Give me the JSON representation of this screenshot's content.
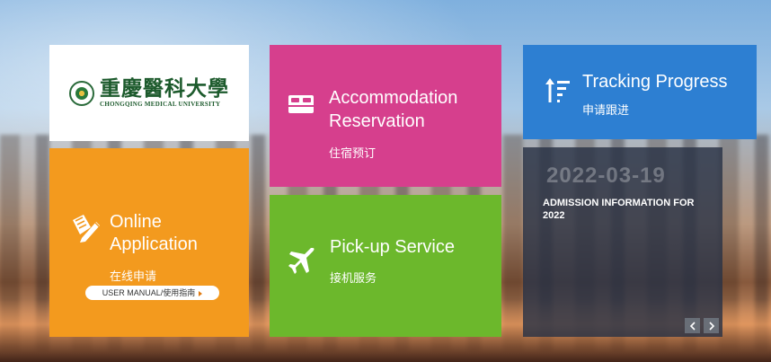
{
  "logo": {
    "name_cn": "重慶醫科大學",
    "name_en": "CHONGQING MEDICAL UNIVERSITY",
    "icon": "university-seal-icon"
  },
  "tiles": {
    "online": {
      "title": "Online Application",
      "subtitle": "在线申请",
      "manual_label": "USER MANUAL/使用指南",
      "icon": "edit-document-icon",
      "color": "#f39a1e"
    },
    "accommodation": {
      "title": "Accommodation Reservation",
      "subtitle": "住宿预订",
      "icon": "bed-icon",
      "color": "#d63f8d"
    },
    "pickup": {
      "title": "Pick-up Service",
      "subtitle": "接机服务",
      "icon": "airplane-icon",
      "color": "#6cb82c"
    },
    "tracking": {
      "title": "Tracking Progress",
      "subtitle": "申请跟进",
      "icon": "sort-progress-icon",
      "color": "#2d7fd2"
    },
    "news": {
      "date": "2022-03-19",
      "headline": "ADMISSION INFORMATION FOR 2022",
      "prev_icon": "chevron-left-icon",
      "next_icon": "chevron-right-icon"
    }
  }
}
